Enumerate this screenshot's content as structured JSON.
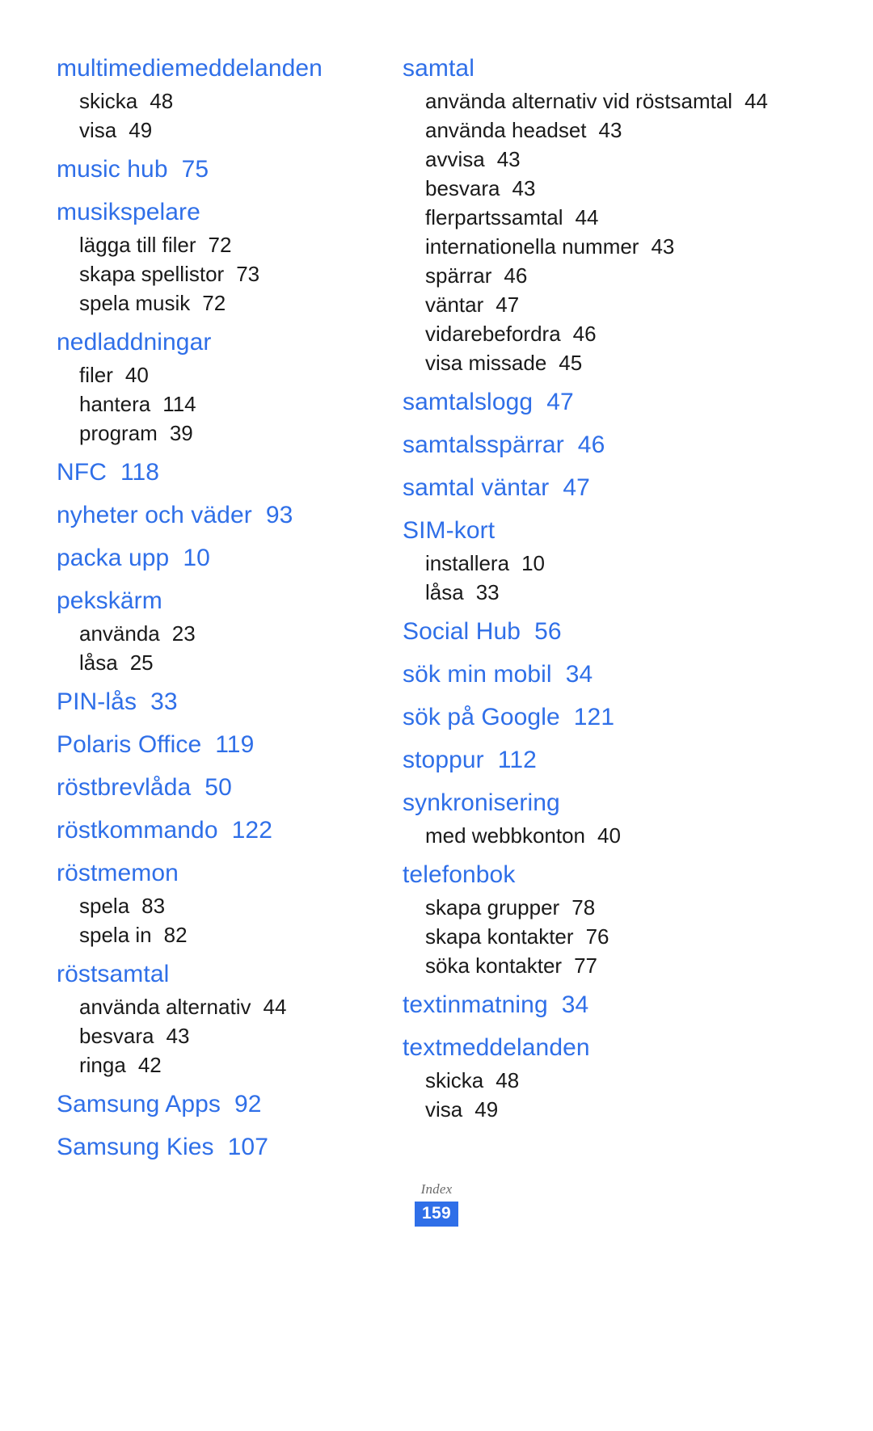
{
  "document": {
    "type": "index-page",
    "language": "sv",
    "accent_color": "#2f6fe8",
    "body_color": "#1a1a1a",
    "background_color": "#ffffff"
  },
  "footer": {
    "label": "Index",
    "page_number": "159"
  },
  "columns": [
    {
      "id": "left",
      "entries": [
        {
          "title": "multimediemeddelanden",
          "page": "",
          "subs": [
            {
              "label": "skicka",
              "page": "48"
            },
            {
              "label": "visa",
              "page": "49"
            }
          ]
        },
        {
          "title": "music hub",
          "page": "75",
          "subs": []
        },
        {
          "title": "musikspelare",
          "page": "",
          "subs": [
            {
              "label": "lägga till filer",
              "page": "72"
            },
            {
              "label": "skapa spellistor",
              "page": "73"
            },
            {
              "label": "spela musik",
              "page": "72"
            }
          ]
        },
        {
          "title": "nedladdningar",
          "page": "",
          "subs": [
            {
              "label": "filer",
              "page": "40"
            },
            {
              "label": "hantera",
              "page": "114"
            },
            {
              "label": "program",
              "page": "39"
            }
          ]
        },
        {
          "title": "NFC",
          "page": "118",
          "subs": []
        },
        {
          "title": "nyheter och väder",
          "page": "93",
          "subs": []
        },
        {
          "title": "packa upp",
          "page": "10",
          "subs": []
        },
        {
          "title": "pekskärm",
          "page": "",
          "subs": [
            {
              "label": "använda",
              "page": "23"
            },
            {
              "label": "låsa",
              "page": "25"
            }
          ]
        },
        {
          "title": "PIN-lås",
          "page": "33",
          "subs": []
        },
        {
          "title": "Polaris Office",
          "page": "119",
          "subs": []
        },
        {
          "title": "röstbrevlåda",
          "page": "50",
          "subs": []
        },
        {
          "title": "röstkommando",
          "page": "122",
          "subs": []
        },
        {
          "title": "röstmemon",
          "page": "",
          "subs": [
            {
              "label": "spela",
              "page": "83"
            },
            {
              "label": "spela in",
              "page": "82"
            }
          ]
        },
        {
          "title": "röstsamtal",
          "page": "",
          "subs": [
            {
              "label": "använda alternativ",
              "page": "44"
            },
            {
              "label": "besvara",
              "page": "43"
            },
            {
              "label": "ringa",
              "page": "42"
            }
          ]
        },
        {
          "title": "Samsung Apps",
          "page": "92",
          "subs": []
        },
        {
          "title": "Samsung Kies",
          "page": "107",
          "subs": []
        }
      ]
    },
    {
      "id": "right",
      "entries": [
        {
          "title": "samtal",
          "page": "",
          "subs": [
            {
              "label": "använda alternativ vid röstsamtal",
              "page": "44",
              "wrap": true
            },
            {
              "label": "använda headset",
              "page": "43"
            },
            {
              "label": "avvisa",
              "page": "43"
            },
            {
              "label": "besvara",
              "page": "43"
            },
            {
              "label": "flerpartssamtal",
              "page": "44"
            },
            {
              "label": "internationella nummer",
              "page": "43"
            },
            {
              "label": "spärrar",
              "page": "46"
            },
            {
              "label": "väntar",
              "page": "47"
            },
            {
              "label": "vidarebefordra",
              "page": "46"
            },
            {
              "label": "visa missade",
              "page": "45"
            }
          ]
        },
        {
          "title": "samtalslogg",
          "page": "47",
          "subs": []
        },
        {
          "title": "samtalsspärrar",
          "page": "46",
          "subs": []
        },
        {
          "title": "samtal väntar",
          "page": "47",
          "subs": []
        },
        {
          "title": "SIM-kort",
          "page": "",
          "subs": [
            {
              "label": "installera",
              "page": "10"
            },
            {
              "label": "låsa",
              "page": "33"
            }
          ]
        },
        {
          "title": "Social Hub",
          "page": "56",
          "subs": []
        },
        {
          "title": "sök min mobil",
          "page": "34",
          "subs": []
        },
        {
          "title": "sök på Google",
          "page": "121",
          "subs": []
        },
        {
          "title": "stoppur",
          "page": "112",
          "subs": []
        },
        {
          "title": "synkronisering",
          "page": "",
          "subs": [
            {
              "label": "med webbkonton",
              "page": "40"
            }
          ]
        },
        {
          "title": "telefonbok",
          "page": "",
          "subs": [
            {
              "label": "skapa grupper",
              "page": "78"
            },
            {
              "label": "skapa kontakter",
              "page": "76"
            },
            {
              "label": "söka kontakter",
              "page": "77"
            }
          ]
        },
        {
          "title": "textinmatning",
          "page": "34",
          "subs": []
        },
        {
          "title": "textmeddelanden",
          "page": "",
          "subs": [
            {
              "label": "skicka",
              "page": "48"
            },
            {
              "label": "visa",
              "page": "49"
            }
          ]
        }
      ]
    }
  ]
}
